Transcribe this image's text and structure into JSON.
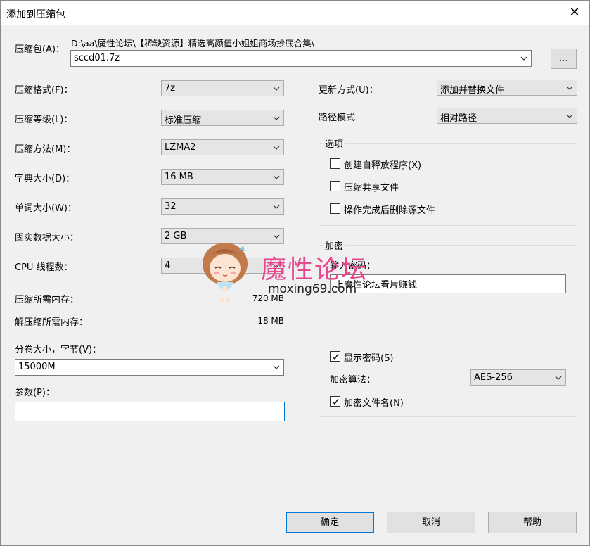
{
  "window": {
    "title": "添加到压缩包",
    "close_glyph": "✕"
  },
  "archive": {
    "label": "压缩包(A)：",
    "path": "D:\\aa\\魔性论坛\\【稀缺资源】精选高颜值小姐姐商场抄底合集\\",
    "filename": "sccd01.7z",
    "browse_label": "..."
  },
  "left": {
    "format": {
      "label": "压缩格式(F)：",
      "value": "7z"
    },
    "level": {
      "label": "压缩等级(L)：",
      "value": "标准压缩"
    },
    "method": {
      "label": "压缩方法(M)：",
      "value": "LZMA2"
    },
    "dict": {
      "label": "字典大小(D)：",
      "value": "16 MB"
    },
    "word": {
      "label": "单词大小(W)：",
      "value": "32"
    },
    "solid": {
      "label": "固实数据大小：",
      "value": "2 GB"
    },
    "threads": {
      "label": "CPU 线程数：",
      "value": "4"
    },
    "mem_compress": {
      "label": "压缩所需内存：",
      "value": "720 MB"
    },
    "mem_decompress": {
      "label": "解压缩所需内存：",
      "value": "18 MB"
    },
    "volume": {
      "label": "分卷大小，字节(V)：",
      "value": "15000M"
    },
    "params": {
      "label": "参数(P)：",
      "value": ""
    }
  },
  "right": {
    "update": {
      "label": "更新方式(U)：",
      "value": "添加并替换文件"
    },
    "path_mode": {
      "label": "路径模式",
      "value": "相对路径"
    },
    "options": {
      "title": "选项",
      "sfx": {
        "label": "创建自释放程序(X)",
        "checked": false
      },
      "shared": {
        "label": "压缩共享文件",
        "checked": false
      },
      "delete": {
        "label": "操作完成后删除源文件",
        "checked": false
      }
    },
    "encryption": {
      "title": "加密",
      "password_label": "输入密码：",
      "password_value": "上魔性论坛看片赚钱",
      "show_password": {
        "label": "显示密码(S)",
        "checked": true
      },
      "algo_label": "加密算法：",
      "algo_value": "AES-256",
      "encrypt_names": {
        "label": "加密文件名(N)",
        "checked": true
      }
    }
  },
  "buttons": {
    "ok": "确定",
    "cancel": "取消",
    "help": "帮助"
  },
  "watermark": {
    "text": "魔性论坛",
    "url": "moxing69.com"
  },
  "colors": {
    "accent": "#0078d7",
    "watermark": "#e8478f",
    "dialog_bg": "#f0f0f0"
  }
}
